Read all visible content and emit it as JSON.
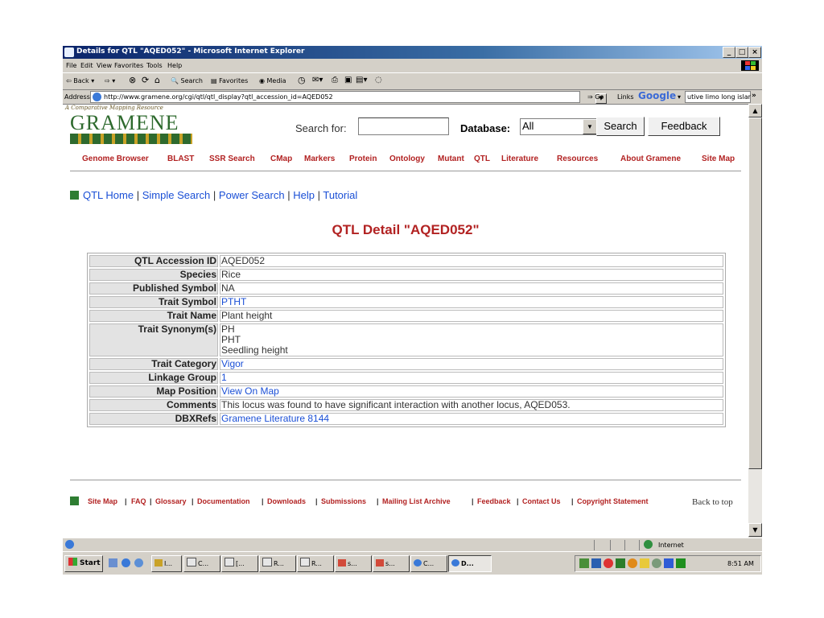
{
  "window": {
    "title": "Details for QTL \"AQED052\" - Microsoft Internet Explorer",
    "buttons": {
      "minimize": "_",
      "maximize": "□",
      "close": "×"
    }
  },
  "menu": [
    "File",
    "Edit",
    "View",
    "Favorites",
    "Tools",
    "Help"
  ],
  "toolbar": {
    "back": "⇦ Back ▾",
    "forward": "⇨ ▾",
    "search": "Search",
    "favorites": "Favorites",
    "media": "Media"
  },
  "address": {
    "label": "Address",
    "url": "http://www.gramene.org/cgi/qtl/qtl_display?qtl_accession_id=AQED052",
    "go": "Go",
    "links": "Links",
    "google": "Google",
    "google_field": "utive limo long islar",
    "more": "»"
  },
  "site": {
    "tagline": "A Comparative Mapping Resource",
    "logo": "GRAMENE",
    "search_label": "Search for:",
    "search_value": "",
    "database_label": "Database:",
    "database_value": "All",
    "search_button": "Search",
    "feedback_button": "Feedback"
  },
  "nav": [
    "Genome Browser",
    "BLAST",
    "SSR Search",
    "CMap",
    "Markers",
    "Protein",
    "Ontology",
    "Mutant",
    "QTL",
    "Literature",
    "Resources",
    "About Gramene",
    "Site Map"
  ],
  "sublinks": [
    "QTL Home",
    "Simple Search",
    "Power Search",
    "Help",
    "Tutorial"
  ],
  "page_title": "QTL Detail \"AQED052\"",
  "details": [
    {
      "key": "QTL Accession ID",
      "value": "AQED052",
      "link": false
    },
    {
      "key": "Species",
      "value": "Rice",
      "link": false
    },
    {
      "key": "Published Symbol",
      "value": "NA",
      "link": false
    },
    {
      "key": "Trait Symbol",
      "value": "PTHT",
      "link": true
    },
    {
      "key": "Trait Name",
      "value": "Plant height",
      "link": false
    },
    {
      "key": "Trait Synonym(s)",
      "values": [
        "PH",
        "PHT",
        "Seedling height"
      ],
      "link": false
    },
    {
      "key": "Trait Category",
      "value": "Vigor",
      "link": true
    },
    {
      "key": "Linkage Group",
      "value": "1",
      "link": true
    },
    {
      "key": "Map Position",
      "value": "View On Map",
      "link": true
    },
    {
      "key": "Comments",
      "value": "This locus was found to have significant interaction with another locus, AQED053.",
      "link": false
    },
    {
      "key": "DBXRefs",
      "value": "Gramene Literature 8144",
      "link": true
    }
  ],
  "footer": {
    "links": [
      "Site Map",
      "FAQ",
      "Glossary",
      "Documentation",
      "Downloads",
      "Submissions",
      "Mailing List Archive",
      "Feedback",
      "Contact Us",
      "Copyright Statement"
    ],
    "back_to_top": "Back to top"
  },
  "statusbar": {
    "zone": "Internet"
  },
  "taskbar": {
    "start": "Start",
    "buttons": [
      "I...",
      "C...",
      "[...",
      "R...",
      "R...",
      "s...",
      "s...",
      "C...",
      "D..."
    ],
    "clock": "8:51 AM"
  }
}
